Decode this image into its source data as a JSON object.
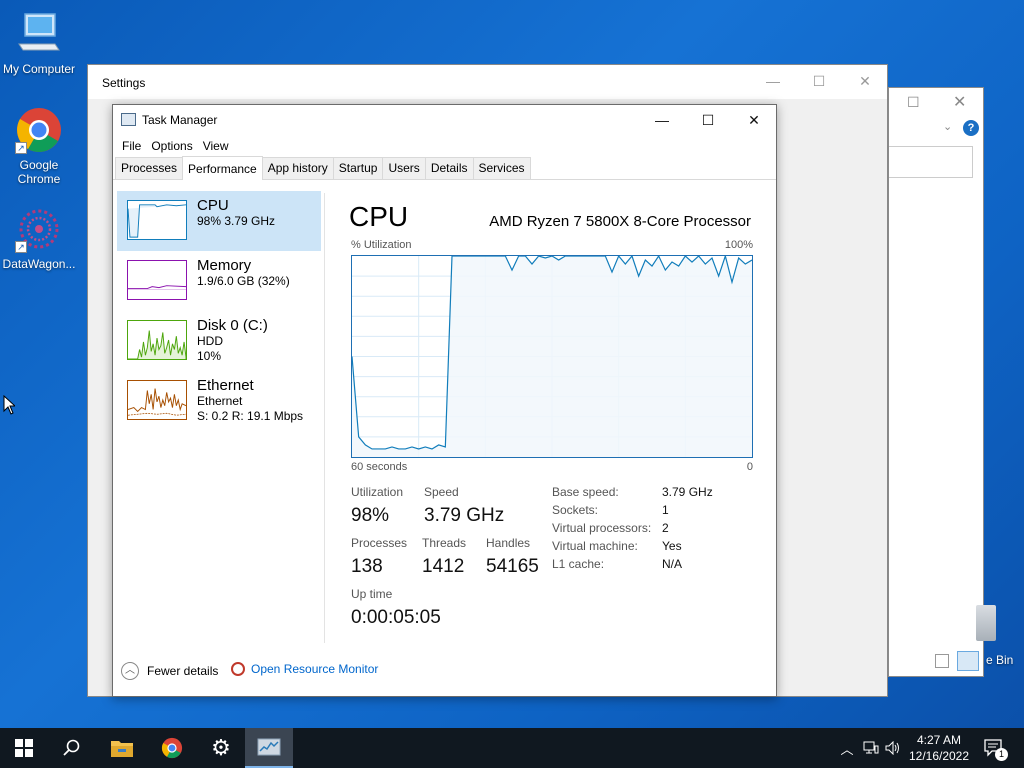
{
  "desktop": {
    "icons": [
      {
        "label": "My Computer"
      },
      {
        "label": "Google Chrome"
      },
      {
        "label": "DataWagon..."
      }
    ],
    "partial_text": "e Bin"
  },
  "settings_window": {
    "title": "Settings"
  },
  "task_manager": {
    "title": "Task Manager",
    "menu": [
      "File",
      "Options",
      "View"
    ],
    "tabs": [
      "Processes",
      "Performance",
      "App history",
      "Startup",
      "Users",
      "Details",
      "Services"
    ],
    "active_tab": "Performance",
    "sidebar": [
      {
        "name": "CPU",
        "line1": "98%  3.79 GHz",
        "line2": "",
        "color": "#117dbb"
      },
      {
        "name": "Memory",
        "line1": "1.9/6.0 GB (32%)",
        "line2": "",
        "color": "#8b12ae"
      },
      {
        "name": "Disk 0 (C:)",
        "line1": "HDD",
        "line2": "10%",
        "color": "#4da60c"
      },
      {
        "name": "Ethernet",
        "line1": "Ethernet",
        "line2": "S: 0.2  R: 19.1 Mbps",
        "color": "#a74f01"
      }
    ],
    "detail": {
      "heading": "CPU",
      "processor": "AMD Ryzen 7 5800X 8-Core Processor",
      "util_label": "% Utilization",
      "util_max": "100%",
      "time_left": "60 seconds",
      "time_right": "0",
      "stats": {
        "utilization_label": "Utilization",
        "utilization": "98%",
        "speed_label": "Speed",
        "speed": "3.79 GHz",
        "processes_label": "Processes",
        "processes": "138",
        "threads_label": "Threads",
        "threads": "1412",
        "handles_label": "Handles",
        "handles": "54165",
        "uptime_label": "Up time",
        "uptime": "0:00:05:05"
      },
      "specs": [
        {
          "k": "Base speed:",
          "v": "3.79 GHz"
        },
        {
          "k": "Sockets:",
          "v": "1"
        },
        {
          "k": "Virtual processors:",
          "v": "2"
        },
        {
          "k": "Virtual machine:",
          "v": "Yes"
        },
        {
          "k": "L1 cache:",
          "v": "N/A"
        }
      ]
    },
    "footer": {
      "fewer": "Fewer details",
      "resmon": "Open Resource Monitor"
    }
  },
  "chart_data": {
    "type": "line",
    "title": "",
    "xlabel": "",
    "ylabel": "% Utilization",
    "xlim": [
      60,
      0
    ],
    "ylim": [
      0,
      100
    ],
    "x_unit": "seconds ago",
    "series": [
      {
        "values": [
          [
            60,
            50
          ],
          [
            59,
            10
          ],
          [
            58,
            6
          ],
          [
            57,
            4
          ],
          [
            56,
            4
          ],
          [
            55,
            4
          ],
          [
            54,
            5
          ],
          [
            53,
            4
          ],
          [
            52,
            4
          ],
          [
            51,
            5
          ],
          [
            50,
            4
          ],
          [
            49,
            5
          ],
          [
            48,
            4
          ],
          [
            47,
            6
          ],
          [
            46,
            5
          ],
          [
            45,
            100
          ],
          [
            44,
            100
          ],
          [
            43,
            100
          ],
          [
            42,
            100
          ],
          [
            41,
            100
          ],
          [
            40,
            100
          ],
          [
            39,
            100
          ],
          [
            38,
            100
          ],
          [
            37,
            100
          ],
          [
            36,
            93
          ],
          [
            35,
            100
          ],
          [
            34,
            100
          ],
          [
            33,
            96
          ],
          [
            32,
            100
          ],
          [
            31,
            99
          ],
          [
            30,
            100
          ],
          [
            29,
            98
          ],
          [
            28,
            100
          ],
          [
            27,
            100
          ],
          [
            26,
            100
          ],
          [
            25,
            100
          ],
          [
            24,
            100
          ],
          [
            23,
            100
          ],
          [
            22,
            100
          ],
          [
            21,
            92
          ],
          [
            20,
            100
          ],
          [
            19,
            96
          ],
          [
            18,
            100
          ],
          [
            17,
            90
          ],
          [
            16,
            98
          ],
          [
            15,
            95
          ],
          [
            14,
            100
          ],
          [
            13,
            93
          ],
          [
            12,
            97
          ],
          [
            11,
            95
          ],
          [
            10,
            100
          ],
          [
            9,
            97
          ],
          [
            8,
            100
          ],
          [
            7,
            96
          ],
          [
            6,
            99
          ],
          [
            5,
            90
          ],
          [
            4,
            100
          ],
          [
            3,
            87
          ],
          [
            2,
            99
          ],
          [
            1,
            96
          ],
          [
            0,
            98
          ]
        ]
      }
    ]
  },
  "taskbar": {
    "clock_time": "4:27 AM",
    "clock_date": "12/16/2022",
    "notification_count": "1"
  }
}
